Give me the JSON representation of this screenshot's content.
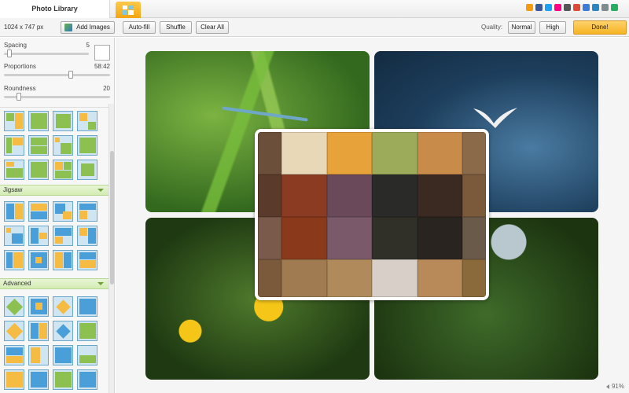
{
  "window": {
    "tab_title": "Photo Library"
  },
  "toolbar": {
    "canvas_size": "1024 x 747 px",
    "add_images": "Add Images",
    "auto_fill": "Auto-fill",
    "shuffle": "Shuffle",
    "clear_all": "Clear All",
    "quality_label": "Quality:",
    "quality_normal": "Normal",
    "quality_high": "High",
    "done": "Done!"
  },
  "social_icons": [
    {
      "name": "home-icon",
      "color": "#f39c12"
    },
    {
      "name": "facebook-icon",
      "color": "#3b5998"
    },
    {
      "name": "twitter-icon",
      "color": "#1da1f2"
    },
    {
      "name": "flickr-icon",
      "color": "#ff0084"
    },
    {
      "name": "digg-icon",
      "color": "#555555"
    },
    {
      "name": "googleplus-icon",
      "color": "#dd4b39"
    },
    {
      "name": "share-icon",
      "color": "#3b7dd8"
    },
    {
      "name": "globe-icon",
      "color": "#2e86c1"
    },
    {
      "name": "mail-icon",
      "color": "#7f8c8d"
    },
    {
      "name": "fullscreen-icon",
      "color": "#27ae60"
    }
  ],
  "panel": {
    "spacing": {
      "label": "Spacing",
      "value": "5",
      "level": 0.05
    },
    "proportions": {
      "label": "Proportions",
      "value": "58:42",
      "level": 0.62
    },
    "roundness": {
      "label": "Roundness",
      "value": "20",
      "level": 0.13
    },
    "sections": {
      "jigsaw": "Jigsaw",
      "advanced": "Advanced"
    }
  },
  "status": {
    "zoom": "91%"
  },
  "colors": {
    "accent": "#f5b322",
    "section": "#d3ecb3"
  }
}
